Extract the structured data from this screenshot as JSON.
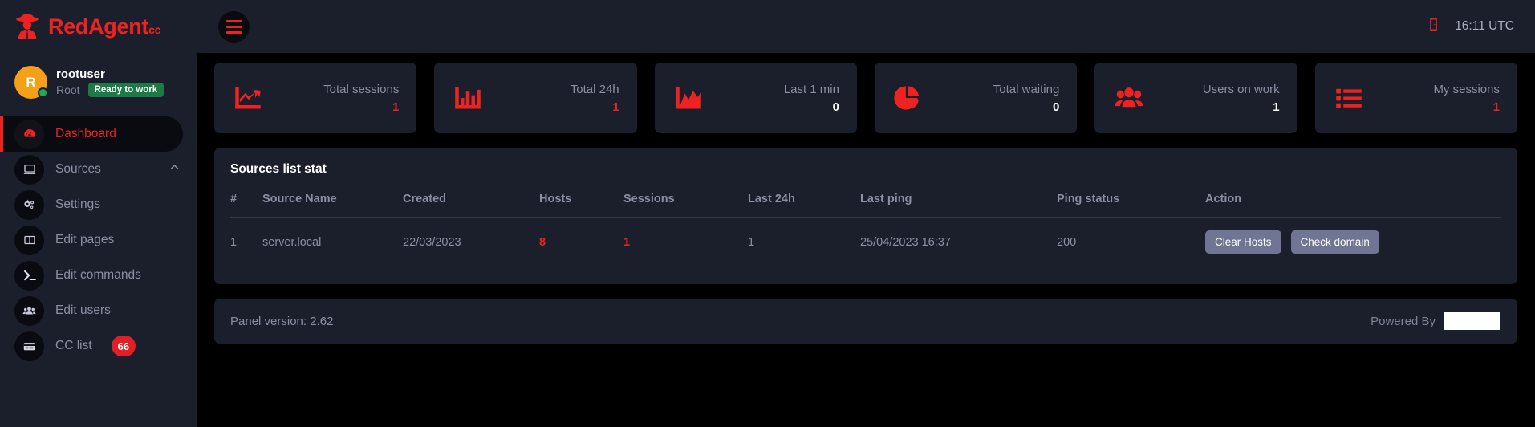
{
  "brand": {
    "name": "RedAgent",
    "suffix": "cc",
    "icon": "spy-agent-icon",
    "color": "#ef2222"
  },
  "profile": {
    "initial": "R",
    "name": "rootuser",
    "role": "Root",
    "status_badge": "Ready to work",
    "status_color": "#1c7a46",
    "online": true
  },
  "sidebar": {
    "items": [
      {
        "label": "Dashboard",
        "icon": "dashboard-gauge-icon",
        "active": true,
        "chevron": false,
        "badge": null
      },
      {
        "label": "Sources",
        "icon": "monitor-icon",
        "active": false,
        "chevron": true,
        "badge": null
      },
      {
        "label": "Settings",
        "icon": "gears-icon",
        "active": false,
        "chevron": false,
        "badge": null
      },
      {
        "label": "Edit pages",
        "icon": "columns-layout-icon",
        "active": false,
        "chevron": false,
        "badge": null
      },
      {
        "label": "Edit commands",
        "icon": "terminal-icon",
        "active": false,
        "chevron": false,
        "badge": null
      },
      {
        "label": "Edit users",
        "icon": "users-icon",
        "active": false,
        "chevron": false,
        "badge": null
      },
      {
        "label": "CC list",
        "icon": "credit-card-icon",
        "active": false,
        "chevron": false,
        "badge": "66"
      }
    ]
  },
  "topbar": {
    "menu_icon": "hamburger-icon",
    "logout_icon": "door-exit-icon",
    "clock": "16:11 UTC"
  },
  "stats": [
    {
      "label": "Total sessions",
      "value": "1",
      "value_color": "red",
      "icon": "line-chart-up-icon"
    },
    {
      "label": "Total 24h",
      "value": "1",
      "value_color": "red",
      "icon": "bar-chart-icon"
    },
    {
      "label": "Last 1 min",
      "value": "0",
      "value_color": "white",
      "icon": "area-chart-icon"
    },
    {
      "label": "Total waiting",
      "value": "0",
      "value_color": "white",
      "icon": "pie-chart-icon"
    },
    {
      "label": "Users on work",
      "value": "1",
      "value_color": "white",
      "icon": "group-users-icon"
    },
    {
      "label": "My sessions",
      "value": "1",
      "value_color": "red",
      "icon": "list-icon"
    }
  ],
  "panel": {
    "title": "Sources list stat",
    "columns": [
      "#",
      "Source Name",
      "Created",
      "Hosts",
      "Sessions",
      "Last 24h",
      "Last ping",
      "Ping status",
      "Action"
    ],
    "rows": [
      {
        "index": "1",
        "source_name": "server.local",
        "created": "22/03/2023",
        "hosts": "8",
        "sessions": "1",
        "last_24h": "1",
        "last_ping": "25/04/2023 16:37",
        "ping_status": "200",
        "actions": [
          "Clear Hosts",
          "Check domain"
        ]
      }
    ]
  },
  "footer": {
    "version_text": "Panel version: 2.62",
    "powered_label": "Powered By"
  }
}
